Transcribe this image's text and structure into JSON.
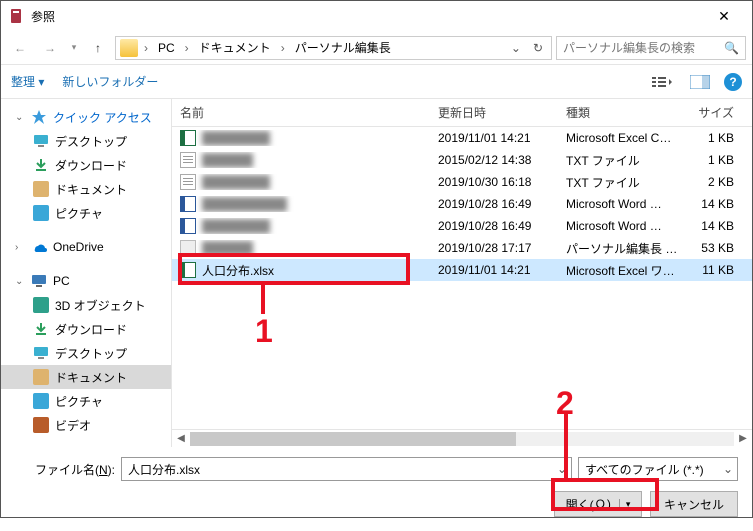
{
  "window": {
    "title": "参照"
  },
  "breadcrumb": {
    "pc": "PC",
    "docs": "ドキュメント",
    "cur": "パーソナル編集長"
  },
  "search": {
    "placeholder": "パーソナル編集長の検索"
  },
  "toolbar": {
    "organize": "整理",
    "newfolder": "新しいフォルダー"
  },
  "tree": {
    "quick": "クイック アクセス",
    "desktop": "デスクトップ",
    "download": "ダウンロード",
    "document": "ドキュメント",
    "picture": "ピクチャ",
    "onedrive": "OneDrive",
    "pc": "PC",
    "obj3d": "3D オブジェクト",
    "download2": "ダウンロード",
    "desktop2": "デスクトップ",
    "document2": "ドキュメント",
    "picture2": "ピクチャ",
    "video": "ビデオ"
  },
  "cols": {
    "name": "名前",
    "date": "更新日時",
    "type": "種類",
    "size": "サイズ"
  },
  "rows": [
    {
      "name": "████████",
      "date": "2019/11/01 14:21",
      "type": "Microsoft Excel CS…",
      "size": "1 KB",
      "ico": "xls",
      "blur": true
    },
    {
      "name": "██████",
      "date": "2015/02/12 14:38",
      "type": "TXT ファイル",
      "size": "1 KB",
      "ico": "txt",
      "blur": true
    },
    {
      "name": "████████",
      "date": "2019/10/30 16:18",
      "type": "TXT ファイル",
      "size": "2 KB",
      "ico": "txt",
      "blur": true
    },
    {
      "name": "██████████",
      "date": "2019/10/28 16:49",
      "type": "Microsoft Word …",
      "size": "14 KB",
      "ico": "wrd",
      "blur": true
    },
    {
      "name": "████████",
      "date": "2019/10/28 16:49",
      "type": "Microsoft Word …",
      "size": "14 KB",
      "ico": "wrd",
      "blur": true
    },
    {
      "name": "██████",
      "date": "2019/10/28 17:17",
      "type": "パーソナル編集長 文…",
      "size": "53 KB",
      "ico": "app",
      "blur": true
    },
    {
      "name": "人口分布.xlsx",
      "date": "2019/11/01 14:21",
      "type": "Microsoft Excel ワ…",
      "size": "11 KB",
      "ico": "xls",
      "sel": true
    }
  ],
  "filename": {
    "label": "ファイル名(N):",
    "value": "人口分布.xlsx"
  },
  "filter": {
    "value": "すべてのファイル (*.*)"
  },
  "buttons": {
    "open": "開く(O)",
    "cancel": "キャンセル"
  },
  "annot": {
    "n1": "1",
    "n2": "2"
  }
}
